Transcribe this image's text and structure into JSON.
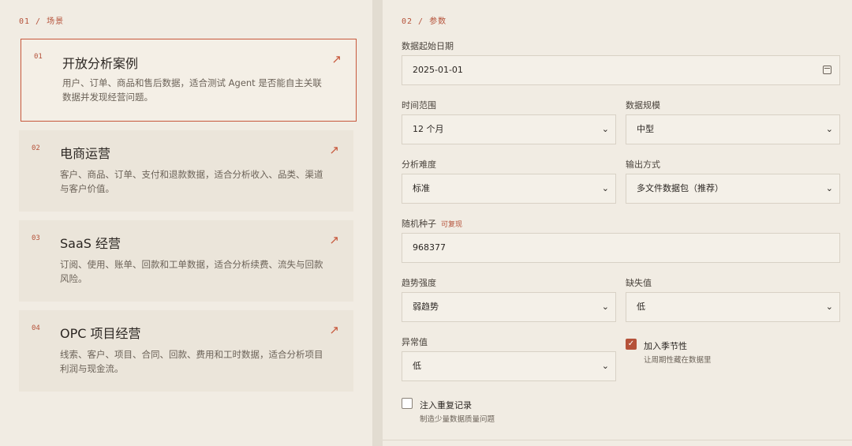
{
  "scenes": {
    "section_label": "01 / 场景",
    "items": [
      {
        "num": "01",
        "title": "开放分析案例",
        "desc": "用户、订单、商品和售后数据，适合测试 Agent 是否能自主关联数据并发现经营问题。",
        "active": true
      },
      {
        "num": "02",
        "title": "电商运营",
        "desc": "客户、商品、订单、支付和退款数据，适合分析收入、品类、渠道与客户价值。"
      },
      {
        "num": "03",
        "title": "SaaS 经营",
        "desc": "订阅、使用、账单、回款和工单数据，适合分析续费、流失与回款风险。"
      },
      {
        "num": "04",
        "title": "OPC 项目经营",
        "desc": "线索、客户、项目、合同、回款、费用和工时数据，适合分析项目利润与现金流。"
      }
    ],
    "arrow_icon": "↗"
  },
  "params": {
    "section_label": "02 / 参数",
    "start_date": {
      "label": "数据起始日期",
      "value": "2025-01-01"
    },
    "time_range": {
      "label": "时间范围",
      "value": "12 个月"
    },
    "data_scale": {
      "label": "数据规模",
      "value": "中型"
    },
    "difficulty": {
      "label": "分析难度",
      "value": "标准"
    },
    "output_mode": {
      "label": "输出方式",
      "value": "多文件数据包（推荐）"
    },
    "seed": {
      "label": "随机种子",
      "tag": "可复现",
      "value": "968377"
    },
    "trend": {
      "label": "趋势强度",
      "value": "弱趋势"
    },
    "missing": {
      "label": "缺失值",
      "value": "低"
    },
    "anomaly": {
      "label": "异常值",
      "value": "低"
    },
    "seasonality": {
      "title": "加入季节性",
      "sub": "让周期性藏在数据里",
      "checked": true
    },
    "duplicates": {
      "title": "注入重复记录",
      "sub": "制造少量数据质量问题",
      "checked": false
    },
    "chevron_icon": "⌄",
    "check_icon": "✓"
  }
}
